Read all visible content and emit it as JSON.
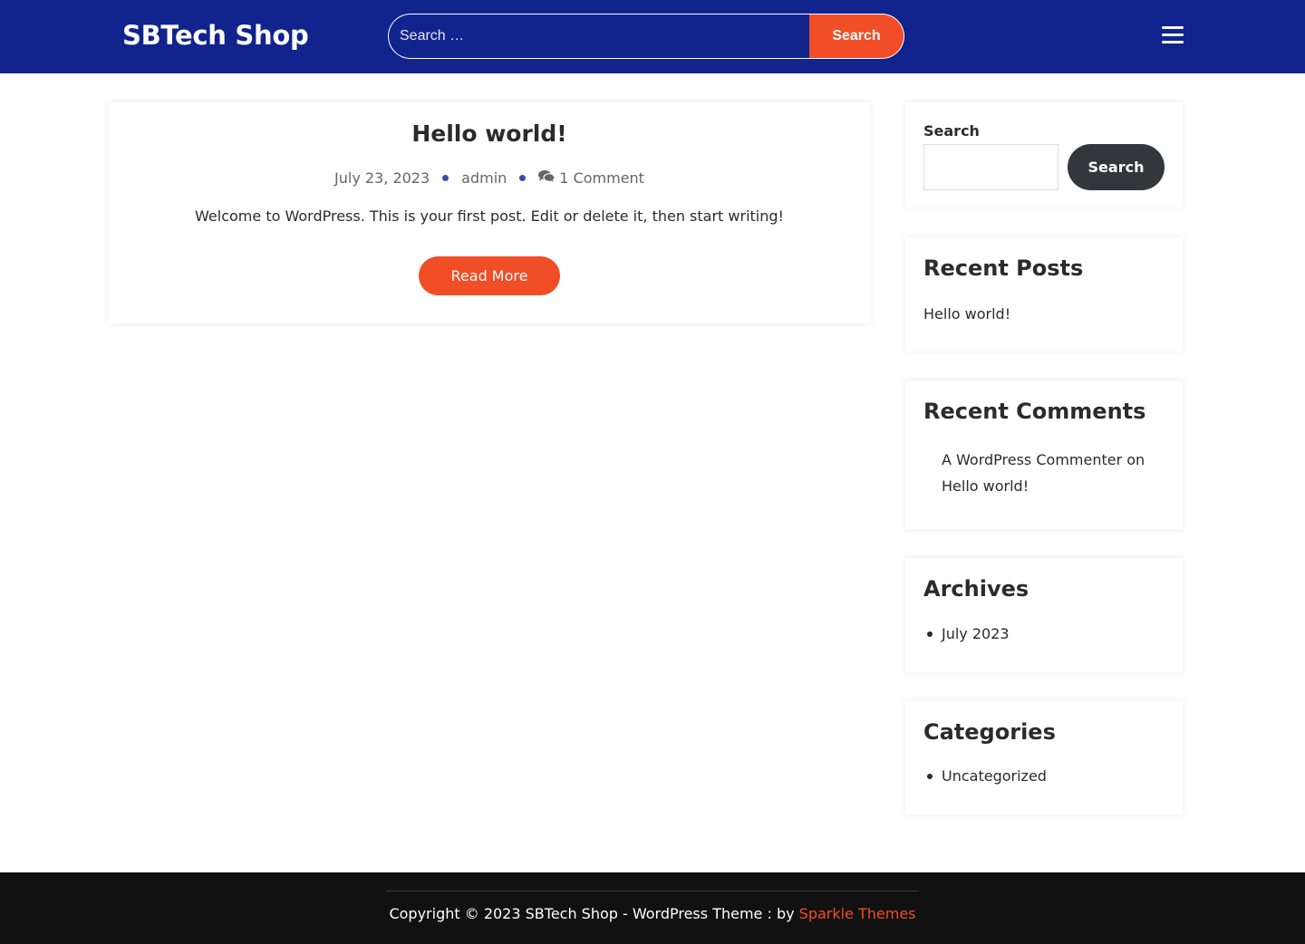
{
  "header": {
    "site_title": "SBTech Shop",
    "search_placeholder": "Search …",
    "search_button": "Search"
  },
  "post": {
    "title": "Hello world!",
    "date": "July 23, 2023",
    "author": "admin",
    "comments": "1 Comment",
    "excerpt": "Welcome to WordPress. This is your first post. Edit or delete it, then start writing!",
    "read_more": "Read More"
  },
  "sidebar": {
    "search": {
      "label": "Search",
      "button": "Search"
    },
    "recent_posts": {
      "title": "Recent Posts",
      "items": [
        "Hello world!"
      ]
    },
    "recent_comments": {
      "title": "Recent Comments",
      "author": "A WordPress Commenter",
      "connector": "on",
      "post": "Hello world!"
    },
    "archives": {
      "title": "Archives",
      "items": [
        "July 2023"
      ]
    },
    "categories": {
      "title": "Categories",
      "items": [
        "Uncategorized"
      ]
    }
  },
  "footer": {
    "copyright": "Copyright © 2023 SBTech Shop - WordPress Theme : by ",
    "link_text": "Sparkle Themes"
  },
  "colors": {
    "header_bg": "#11238c",
    "accent": "#f14d26",
    "footer_bg": "#111111",
    "button_dark": "#32373c"
  }
}
